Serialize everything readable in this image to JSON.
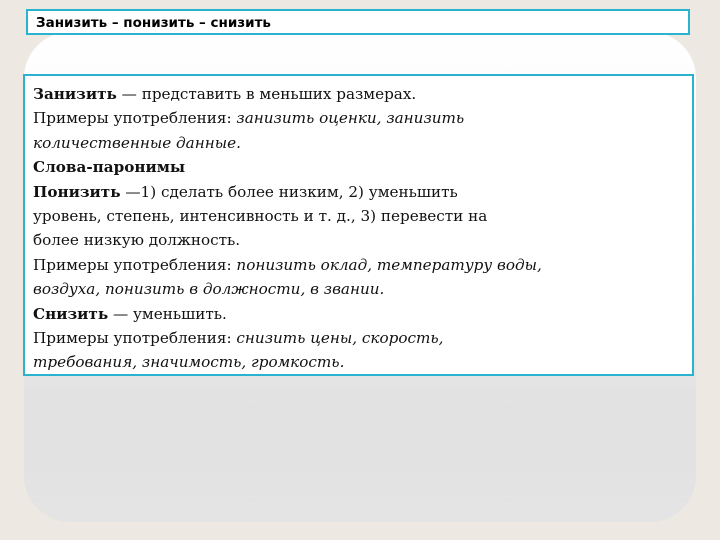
{
  "slide": {
    "title": "Занизить – понизить – снизить"
  },
  "content": {
    "zanizit": {
      "term": "Занизить",
      "definition": " — представить в меньших размерах.",
      "usage_label": "Примеры употребления: ",
      "usage_line1": "занизить оценки, занизить",
      "usage_line2": "количественные данные."
    },
    "paronyms_heading": "Слова-паронимы",
    "ponizit": {
      "term": "Понизить",
      "definition_line1": " —1) сделать более низким, 2) уменьшить",
      "definition_line2": "уровень, степень, интенсивность и т. д., 3) перевести на",
      "definition_line3": "более низкую должность.",
      "usage_label": "Примеры употребления: ",
      "usage_line1": "понизить оклад, температуру воды,",
      "usage_line2": "воздуха, понизить в должности, в звании."
    },
    "snizit": {
      "term": "Снизить",
      "definition": " — уменьшить.",
      "usage_label": "Примеры употребления: ",
      "usage_line1": "снизить цены, скорость,",
      "usage_line2": "требования, значимость, громкость."
    }
  }
}
